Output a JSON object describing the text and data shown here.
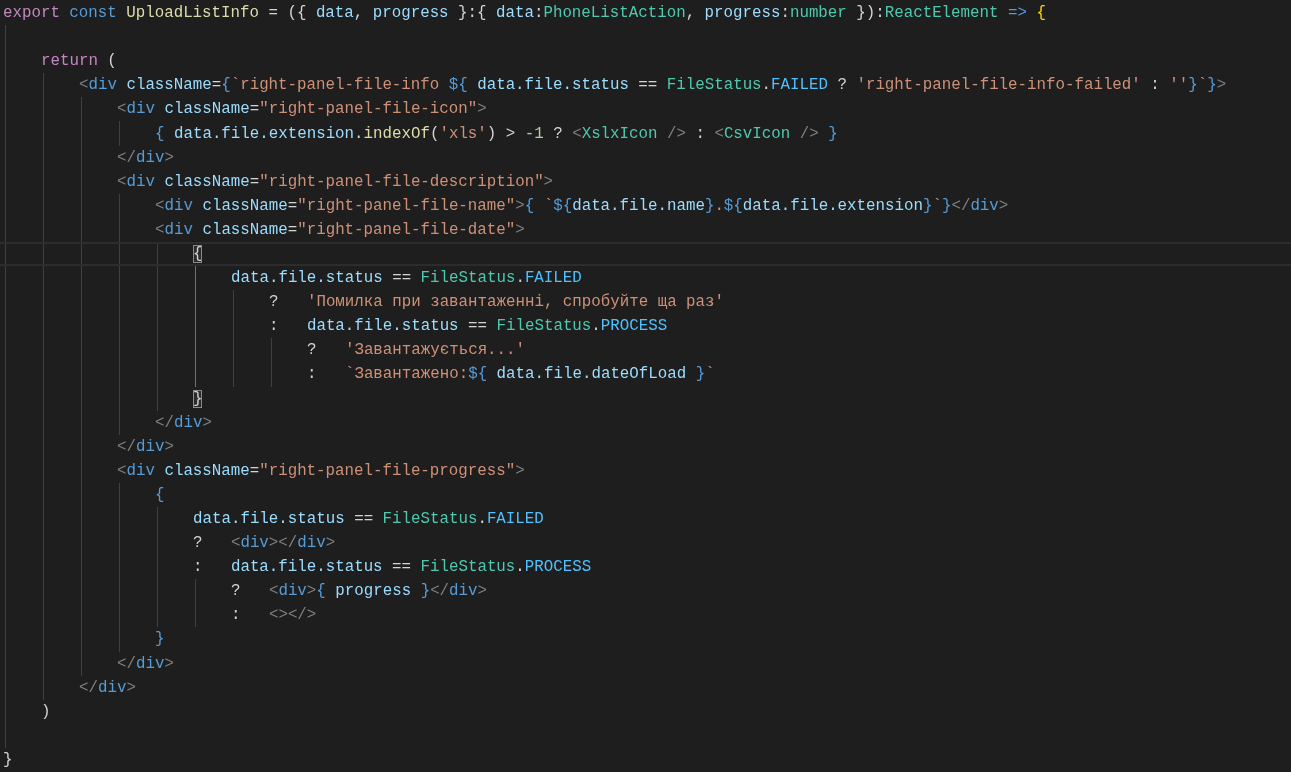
{
  "editor": {
    "lines": [
      {
        "kind": "code",
        "current": false,
        "tokens": [
          {
            "text": "export",
            "kind": "keyword"
          },
          {
            "text": " const",
            "kind": "storage"
          },
          {
            "text": " UploadListInfo",
            "kind": "function"
          },
          {
            "text": " = ({ ",
            "kind": "punct"
          },
          {
            "text": "data",
            "kind": "variable"
          },
          {
            "text": ", ",
            "kind": "punct"
          },
          {
            "text": "progress",
            "kind": "variable"
          },
          {
            "text": " }:{ ",
            "kind": "punct"
          },
          {
            "text": "data",
            "kind": "variable"
          },
          {
            "text": ":",
            "kind": "punct"
          },
          {
            "text": "PhoneListAction",
            "kind": "type"
          },
          {
            "text": ", ",
            "kind": "punct"
          },
          {
            "text": "progress",
            "kind": "variable"
          },
          {
            "text": ":",
            "kind": "punct"
          },
          {
            "text": "number",
            "kind": "type"
          },
          {
            "text": " }):",
            "kind": "punct"
          },
          {
            "text": "ReactElement",
            "kind": "type"
          },
          {
            "text": " =>",
            "kind": "storage"
          },
          {
            "text": " {",
            "kind": "bracket"
          }
        ]
      },
      {
        "kind": "blank",
        "current": false
      },
      {
        "kind": "code",
        "current": false,
        "tokens": [
          {
            "text": "    return",
            "kind": "keyword"
          },
          {
            "text": " (",
            "kind": "punct"
          }
        ]
      },
      {
        "kind": "code",
        "current": false,
        "tokens": [
          {
            "text": "        <",
            "kind": "tag_punct"
          },
          {
            "text": "div",
            "kind": "storage"
          },
          {
            "text": " className",
            "kind": "variable"
          },
          {
            "text": "=",
            "kind": "punct"
          },
          {
            "text": "{",
            "kind": "storage"
          },
          {
            "text": "`right-panel-file-info ",
            "kind": "string"
          },
          {
            "text": "${",
            "kind": "storage"
          },
          {
            "text": " data.file.status",
            "kind": "variable"
          },
          {
            "text": " == ",
            "kind": "punct"
          },
          {
            "text": "FileStatus",
            "kind": "type"
          },
          {
            "text": ".",
            "kind": "punct"
          },
          {
            "text": "FAILED",
            "kind": "constant"
          },
          {
            "text": " ? ",
            "kind": "punct"
          },
          {
            "text": "'right-panel-file-info-failed'",
            "kind": "string"
          },
          {
            "text": " : ",
            "kind": "punct"
          },
          {
            "text": "''",
            "kind": "string"
          },
          {
            "text": "}",
            "kind": "storage"
          },
          {
            "text": "`",
            "kind": "string"
          },
          {
            "text": "}",
            "kind": "storage"
          },
          {
            "text": ">",
            "kind": "tag_punct"
          }
        ]
      },
      {
        "kind": "code",
        "current": false,
        "tokens": [
          {
            "text": "            <",
            "kind": "tag_punct"
          },
          {
            "text": "div",
            "kind": "storage"
          },
          {
            "text": " className",
            "kind": "variable"
          },
          {
            "text": "=",
            "kind": "punct"
          },
          {
            "text": "\"right-panel-file-icon\"",
            "kind": "string"
          },
          {
            "text": ">",
            "kind": "tag_punct"
          }
        ]
      },
      {
        "kind": "code",
        "current": false,
        "tokens": [
          {
            "text": "                { ",
            "kind": "storage"
          },
          {
            "text": "data.file.extension",
            "kind": "variable"
          },
          {
            "text": ".",
            "kind": "punct"
          },
          {
            "text": "indexOf",
            "kind": "function"
          },
          {
            "text": "(",
            "kind": "punct"
          },
          {
            "text": "'xls'",
            "kind": "string"
          },
          {
            "text": ") > ",
            "kind": "punct"
          },
          {
            "text": "-1",
            "kind": "number"
          },
          {
            "text": " ? ",
            "kind": "punct"
          },
          {
            "text": "<",
            "kind": "tag_punct"
          },
          {
            "text": "XslxIcon",
            "kind": "type"
          },
          {
            "text": " />",
            "kind": "tag_punct"
          },
          {
            "text": " : ",
            "kind": "punct"
          },
          {
            "text": "<",
            "kind": "tag_punct"
          },
          {
            "text": "CsvIcon",
            "kind": "type"
          },
          {
            "text": " />",
            "kind": "tag_punct"
          },
          {
            "text": " }",
            "kind": "storage"
          }
        ]
      },
      {
        "kind": "code",
        "current": false,
        "tokens": [
          {
            "text": "            </",
            "kind": "tag_punct"
          },
          {
            "text": "div",
            "kind": "storage"
          },
          {
            "text": ">",
            "kind": "tag_punct"
          }
        ]
      },
      {
        "kind": "code",
        "current": false,
        "tokens": [
          {
            "text": "            <",
            "kind": "tag_punct"
          },
          {
            "text": "div",
            "kind": "storage"
          },
          {
            "text": " className",
            "kind": "variable"
          },
          {
            "text": "=",
            "kind": "punct"
          },
          {
            "text": "\"right-panel-file-description\"",
            "kind": "string"
          },
          {
            "text": ">",
            "kind": "tag_punct"
          }
        ]
      },
      {
        "kind": "code",
        "current": false,
        "tokens": [
          {
            "text": "                <",
            "kind": "tag_punct"
          },
          {
            "text": "div",
            "kind": "storage"
          },
          {
            "text": " className",
            "kind": "variable"
          },
          {
            "text": "=",
            "kind": "punct"
          },
          {
            "text": "\"right-panel-file-name\"",
            "kind": "string"
          },
          {
            "text": ">",
            "kind": "tag_punct"
          },
          {
            "text": "{ ",
            "kind": "storage"
          },
          {
            "text": "`",
            "kind": "string"
          },
          {
            "text": "${",
            "kind": "storage"
          },
          {
            "text": "data.file.name",
            "kind": "variable"
          },
          {
            "text": "}",
            "kind": "storage"
          },
          {
            "text": ".",
            "kind": "string"
          },
          {
            "text": "${",
            "kind": "storage"
          },
          {
            "text": "data.file.extension",
            "kind": "variable"
          },
          {
            "text": "}",
            "kind": "storage"
          },
          {
            "text": "`",
            "kind": "string"
          },
          {
            "text": "}",
            "kind": "storage"
          },
          {
            "text": "</",
            "kind": "tag_punct"
          },
          {
            "text": "div",
            "kind": "storage"
          },
          {
            "text": ">",
            "kind": "tag_punct"
          }
        ]
      },
      {
        "kind": "code",
        "current": false,
        "tokens": [
          {
            "text": "                <",
            "kind": "tag_punct"
          },
          {
            "text": "div",
            "kind": "storage"
          },
          {
            "text": " className",
            "kind": "variable"
          },
          {
            "text": "=",
            "kind": "punct"
          },
          {
            "text": "\"right-panel-file-date\"",
            "kind": "string"
          },
          {
            "text": ">",
            "kind": "tag_punct"
          }
        ]
      },
      {
        "kind": "code",
        "current": true,
        "tokens": [
          {
            "text": "                    {",
            "kind": "bracket_match"
          }
        ]
      },
      {
        "kind": "code",
        "current": false,
        "tokens": [
          {
            "text": "                        data.file.status",
            "kind": "variable"
          },
          {
            "text": " == ",
            "kind": "punct"
          },
          {
            "text": "FileStatus",
            "kind": "type"
          },
          {
            "text": ".",
            "kind": "punct"
          },
          {
            "text": "FAILED",
            "kind": "constant"
          }
        ]
      },
      {
        "kind": "code",
        "current": false,
        "tokens": [
          {
            "text": "                            ?   ",
            "kind": "punct"
          },
          {
            "text": "'Помилка при завантаженні, спробуйте ща раз'",
            "kind": "string"
          }
        ]
      },
      {
        "kind": "code",
        "current": false,
        "tokens": [
          {
            "text": "                            :   ",
            "kind": "punct"
          },
          {
            "text": "data.file.status",
            "kind": "variable"
          },
          {
            "text": " == ",
            "kind": "punct"
          },
          {
            "text": "FileStatus",
            "kind": "type"
          },
          {
            "text": ".",
            "kind": "punct"
          },
          {
            "text": "PROCESS",
            "kind": "constant"
          }
        ]
      },
      {
        "kind": "code",
        "current": false,
        "tokens": [
          {
            "text": "                                ?   ",
            "kind": "punct"
          },
          {
            "text": "'Завантажується...'",
            "kind": "string"
          }
        ]
      },
      {
        "kind": "code",
        "current": false,
        "tokens": [
          {
            "text": "                                :   ",
            "kind": "punct"
          },
          {
            "text": "`Завантажено:",
            "kind": "string"
          },
          {
            "text": "${",
            "kind": "storage"
          },
          {
            "text": " data.file.dateOfLoad ",
            "kind": "variable"
          },
          {
            "text": "}",
            "kind": "storage"
          },
          {
            "text": "`",
            "kind": "string"
          }
        ]
      },
      {
        "kind": "code",
        "current": false,
        "tokens": [
          {
            "text": "                    }",
            "kind": "bracket_match"
          }
        ]
      },
      {
        "kind": "code",
        "current": false,
        "tokens": [
          {
            "text": "                </",
            "kind": "tag_punct"
          },
          {
            "text": "div",
            "kind": "storage"
          },
          {
            "text": ">",
            "kind": "tag_punct"
          }
        ]
      },
      {
        "kind": "code",
        "current": false,
        "tokens": [
          {
            "text": "            </",
            "kind": "tag_punct"
          },
          {
            "text": "div",
            "kind": "storage"
          },
          {
            "text": ">",
            "kind": "tag_punct"
          }
        ]
      },
      {
        "kind": "code",
        "current": false,
        "tokens": [
          {
            "text": "            <",
            "kind": "tag_punct"
          },
          {
            "text": "div",
            "kind": "storage"
          },
          {
            "text": " className",
            "kind": "variable"
          },
          {
            "text": "=",
            "kind": "punct"
          },
          {
            "text": "\"right-panel-file-progress\"",
            "kind": "string"
          },
          {
            "text": ">",
            "kind": "tag_punct"
          }
        ]
      },
      {
        "kind": "code",
        "current": false,
        "tokens": [
          {
            "text": "                {",
            "kind": "storage"
          }
        ]
      },
      {
        "kind": "code",
        "current": false,
        "tokens": [
          {
            "text": "                    data.file.status",
            "kind": "variable"
          },
          {
            "text": " == ",
            "kind": "punct"
          },
          {
            "text": "FileStatus",
            "kind": "type"
          },
          {
            "text": ".",
            "kind": "punct"
          },
          {
            "text": "FAILED",
            "kind": "constant"
          }
        ]
      },
      {
        "kind": "code",
        "current": false,
        "tokens": [
          {
            "text": "                    ?   ",
            "kind": "punct"
          },
          {
            "text": "<",
            "kind": "tag_punct"
          },
          {
            "text": "div",
            "kind": "storage"
          },
          {
            "text": "></",
            "kind": "tag_punct"
          },
          {
            "text": "div",
            "kind": "storage"
          },
          {
            "text": ">",
            "kind": "tag_punct"
          }
        ]
      },
      {
        "kind": "code",
        "current": false,
        "tokens": [
          {
            "text": "                    :   ",
            "kind": "punct"
          },
          {
            "text": "data.file.status",
            "kind": "variable"
          },
          {
            "text": " == ",
            "kind": "punct"
          },
          {
            "text": "FileStatus",
            "kind": "type"
          },
          {
            "text": ".",
            "kind": "punct"
          },
          {
            "text": "PROCESS",
            "kind": "constant"
          }
        ]
      },
      {
        "kind": "code",
        "current": false,
        "tokens": [
          {
            "text": "                        ?   ",
            "kind": "punct"
          },
          {
            "text": "<",
            "kind": "tag_punct"
          },
          {
            "text": "div",
            "kind": "storage"
          },
          {
            "text": ">",
            "kind": "tag_punct"
          },
          {
            "text": "{ ",
            "kind": "storage"
          },
          {
            "text": "progress ",
            "kind": "variable"
          },
          {
            "text": "}",
            "kind": "storage"
          },
          {
            "text": "</",
            "kind": "tag_punct"
          },
          {
            "text": "div",
            "kind": "storage"
          },
          {
            "text": ">",
            "kind": "tag_punct"
          }
        ]
      },
      {
        "kind": "code",
        "current": false,
        "tokens": [
          {
            "text": "                        :   ",
            "kind": "punct"
          },
          {
            "text": "<></>",
            "kind": "tag_punct"
          }
        ]
      },
      {
        "kind": "code",
        "current": false,
        "tokens": [
          {
            "text": "                }",
            "kind": "storage"
          }
        ]
      },
      {
        "kind": "code",
        "current": false,
        "tokens": [
          {
            "text": "            </",
            "kind": "tag_punct"
          },
          {
            "text": "div",
            "kind": "storage"
          },
          {
            "text": ">",
            "kind": "tag_punct"
          }
        ]
      },
      {
        "kind": "code",
        "current": false,
        "tokens": [
          {
            "text": "        </",
            "kind": "tag_punct"
          },
          {
            "text": "div",
            "kind": "storage"
          },
          {
            "text": ">",
            "kind": "tag_punct"
          }
        ]
      },
      {
        "kind": "code",
        "current": false,
        "tokens": [
          {
            "text": "    )",
            "kind": "punct"
          }
        ]
      },
      {
        "kind": "blank",
        "current": false
      },
      {
        "kind": "code",
        "current": false,
        "tokens": [
          {
            "text": "}",
            "kind": "punct"
          }
        ]
      }
    ]
  }
}
